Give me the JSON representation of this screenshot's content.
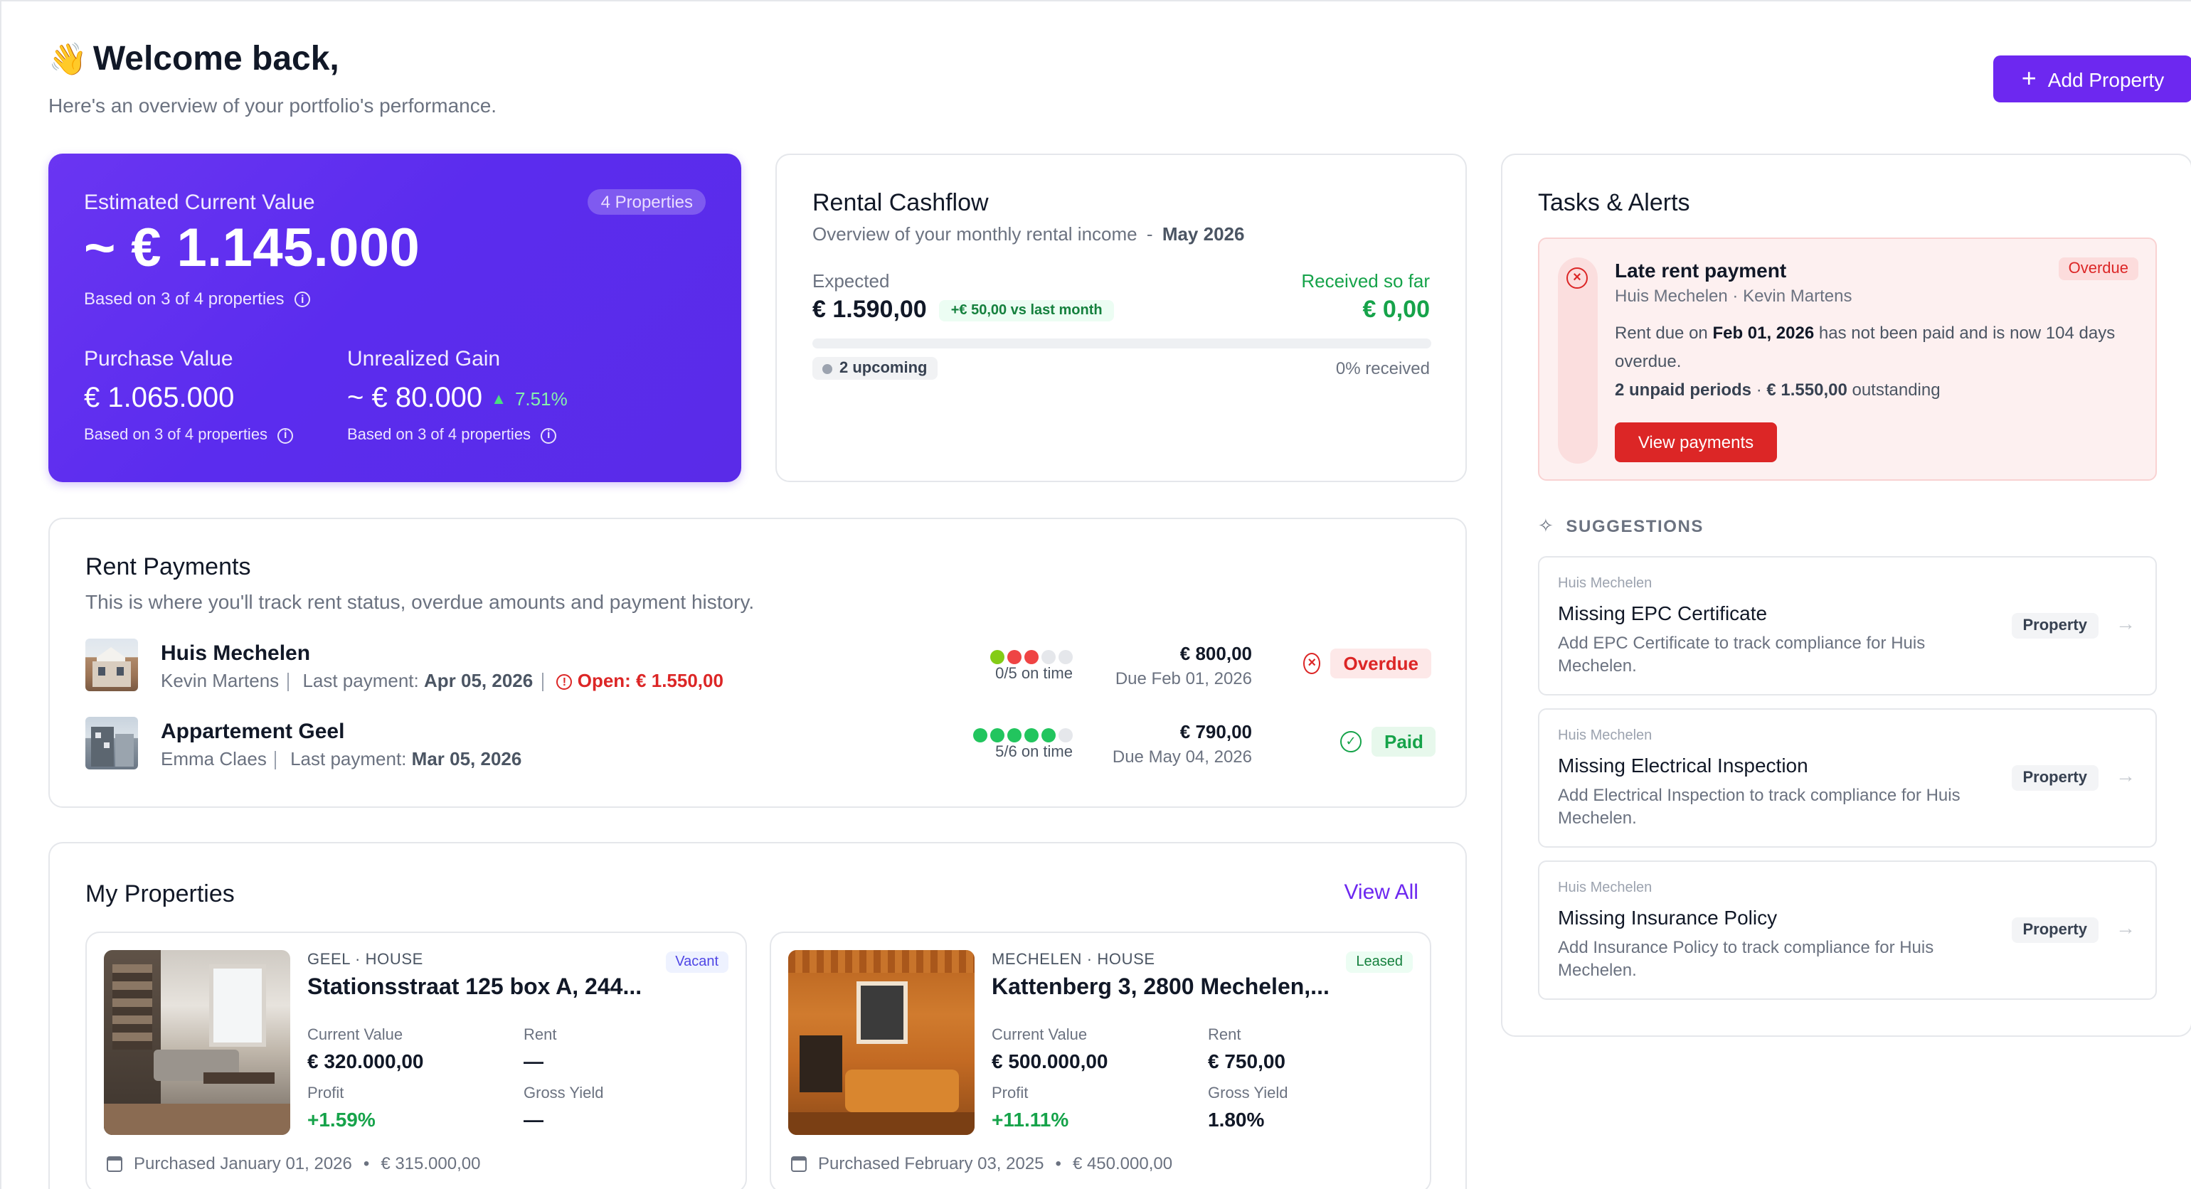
{
  "header": {
    "wave": "👋",
    "title": "Welcome back,",
    "subtitle": "Here's an overview of your portfolio's performance.",
    "add_property": "Add Property"
  },
  "hero": {
    "label": "Estimated Current Value",
    "properties_badge": "4 Properties",
    "value": "~ € 1.145.000",
    "based_on": "Based on 3 of 4 properties",
    "purchase_label": "Purchase Value",
    "purchase_value": "€ 1.065.000",
    "purchase_note": "Based on 3 of 4 properties",
    "gain_label": "Unrealized Gain",
    "gain_value": "~ € 80.000",
    "gain_pct": "7.51%",
    "gain_note": "Based on 3 of 4 properties"
  },
  "cashflow": {
    "title": "Rental Cashflow",
    "subtitle": "Overview of your monthly rental income",
    "dash": "-",
    "month": "May 2026",
    "expected_label": "Expected",
    "expected_value": "€ 1.590,00",
    "delta_badge": "+€ 50,00 vs last month",
    "received_label": "Received so far",
    "received_value": "€ 0,00",
    "progress_fraction": 0,
    "upcoming": "2 upcoming",
    "received_pct": "0% received"
  },
  "rent": {
    "title": "Rent Payments",
    "subtitle": "This is where you'll track rent status, overdue amounts and payment history.",
    "rows": [
      {
        "name": "Huis Mechelen",
        "tenant": "Kevin Martens",
        "last_label": "Last payment:",
        "last_date": "Apr 05, 2026",
        "open": "Open: € 1.550,00",
        "on_time": "0/5 on time",
        "amount": "€ 800,00",
        "due": "Due Feb 01, 2026",
        "status": "Overdue"
      },
      {
        "name": "Appartement Geel",
        "tenant": "Emma Claes",
        "last_label": "Last payment:",
        "last_date": "Mar 05, 2026",
        "on_time": "5/6 on time",
        "amount": "€ 790,00",
        "due": "Due May 04, 2026",
        "status": "Paid"
      }
    ]
  },
  "properties": {
    "title": "My Properties",
    "view_all": "View All",
    "cards": [
      {
        "type": "GEEL · HOUSE",
        "badge": "Vacant",
        "address": "Stationsstraat 125 box A, 244...",
        "cv_label": "Current Value",
        "cv": "€ 320.000,00",
        "rent_label": "Rent",
        "rent": "—",
        "profit_label": "Profit",
        "profit": "+1.59%",
        "yield_label": "Gross Yield",
        "yield": "—",
        "purchased": "Purchased January 01, 2026",
        "bullet": "•",
        "price": "€ 315.000,00"
      },
      {
        "type": "MECHELEN · HOUSE",
        "badge": "Leased",
        "address": "Kattenberg 3, 2800 Mechelen,...",
        "cv_label": "Current Value",
        "cv": "€ 500.000,00",
        "rent_label": "Rent",
        "rent": "€ 750,00",
        "profit_label": "Profit",
        "profit": "+11.11%",
        "yield_label": "Gross Yield",
        "yield": "1.80%",
        "purchased": "Purchased February 03, 2025",
        "bullet": "•",
        "price": "€ 450.000,00"
      }
    ]
  },
  "tasks": {
    "title": "Tasks & Alerts",
    "alert": {
      "title": "Late rent payment",
      "badge": "Overdue",
      "sub": "Huis Mechelen · Kevin Martens",
      "msg_a": "Rent due on ",
      "msg_date": "Feb 01, 2026",
      "msg_b": " has not been paid and is now 104 days overdue.",
      "unpaid": "2 unpaid periods",
      "dot": " · ",
      "outstanding_amount": "€ 1.550,00",
      "outstanding": " outstanding",
      "button": "View payments"
    },
    "suggestions_label": "SUGGESTIONS",
    "suggestions": [
      {
        "owner": "Huis Mechelen",
        "title": "Missing EPC Certificate",
        "desc": "Add EPC Certificate to track compliance for Huis Mechelen.",
        "tag": "Property"
      },
      {
        "owner": "Huis Mechelen",
        "title": "Missing Electrical Inspection",
        "desc": "Add Electrical Inspection to track compliance for Huis Mechelen.",
        "tag": "Property"
      },
      {
        "owner": "Huis Mechelen",
        "title": "Missing Insurance Policy",
        "desc": "Add Insurance Policy to track compliance for Huis Mechelen.",
        "tag": "Property"
      }
    ]
  },
  "colors": {
    "accent": "#6d28f0",
    "success": "#16a34a",
    "danger": "#dc2626"
  }
}
